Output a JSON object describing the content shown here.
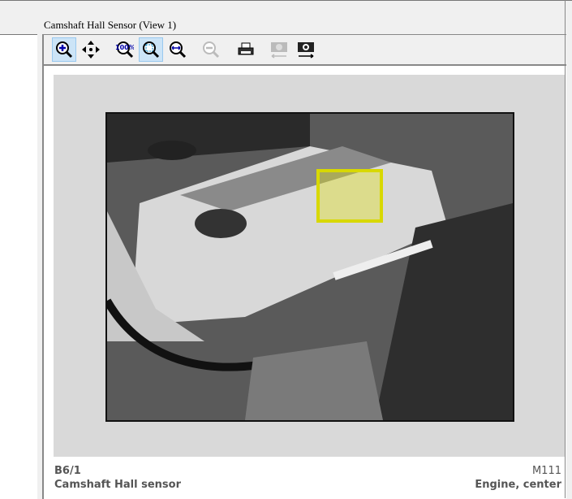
{
  "window": {
    "title": "Camshaft Hall Sensor (View 1)"
  },
  "toolbar": {
    "buttons": [
      {
        "icon": "zoom-in-icon",
        "active": true
      },
      {
        "icon": "pan-icon",
        "active": false
      },
      {
        "icon": "zoom-100-icon",
        "label": "100%",
        "active": false
      },
      {
        "icon": "zoom-fit-icon",
        "active": true
      },
      {
        "icon": "zoom-width-icon",
        "active": false
      },
      {
        "icon": "zoom-out-icon",
        "active": false,
        "disabled": true
      },
      {
        "icon": "print-icon",
        "active": false
      },
      {
        "icon": "previous-view-icon",
        "active": false,
        "disabled": true
      },
      {
        "icon": "next-view-icon",
        "active": false
      }
    ]
  },
  "caption": {
    "code": "B6/1",
    "name": "Camshaft Hall sensor",
    "model": "M111",
    "location": "Engine, center"
  },
  "colors": {
    "highlight": "#d8d800",
    "viewer_bg": "#d9d9d9"
  }
}
